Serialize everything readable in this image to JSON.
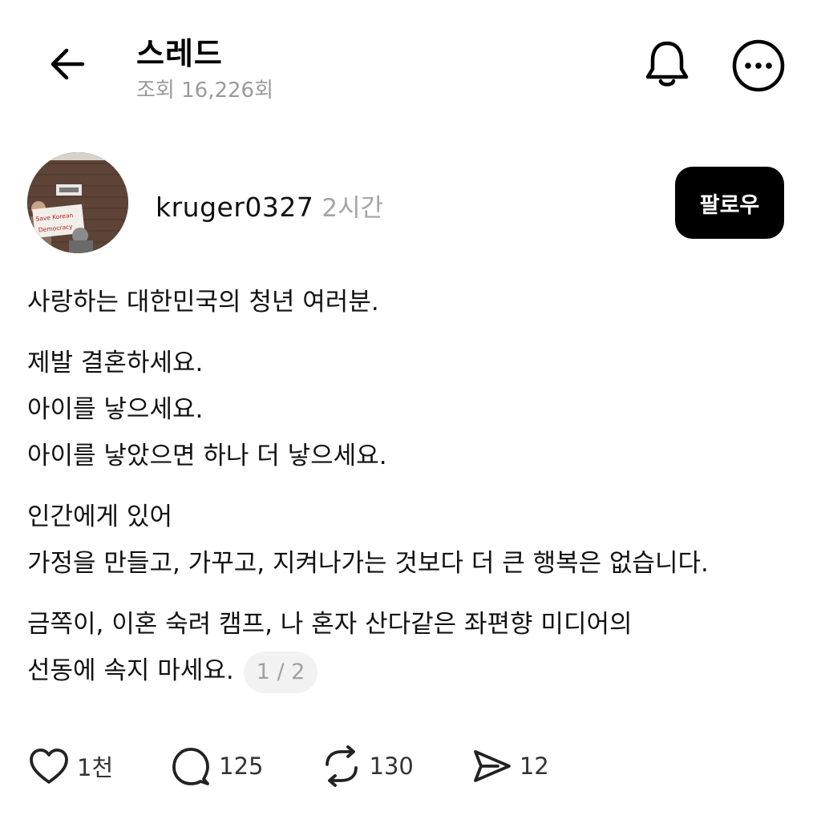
{
  "header": {
    "title": "스레드",
    "views": "조회 16,226회"
  },
  "author": {
    "username": "kruger0327",
    "time": "2시간",
    "follow_label": "팔로우",
    "avatar_sign_line1": "Save Korean",
    "avatar_sign_line2": "Democracy"
  },
  "post": {
    "paragraphs": [
      [
        "사랑하는 대한민국의 청년 여러분."
      ],
      [
        "제발 결혼하세요.",
        "아이를 낳으세요.",
        "아이를 낳았으면 하나 더 낳으세요."
      ],
      [
        "인간에게 있어",
        "가정을 만들고, 가꾸고, 지켜나가는 것보다 더 큰 행복은 없습니다."
      ],
      [
        "금쪽이, 이혼 숙려 캠프, 나 혼자 산다같은 좌편향 미디어의",
        "선동에 속지 마세요."
      ]
    ],
    "page_indicator": "1 / 2"
  },
  "actions": {
    "like_count": "1천",
    "comment_count": "125",
    "repost_count": "130",
    "share_count": "12"
  },
  "icons": {
    "back": "arrow-left-icon",
    "notify": "bell-icon",
    "more": "more-icon",
    "like": "heart-icon",
    "comment": "comment-icon",
    "repost": "repost-icon",
    "share": "send-icon"
  }
}
